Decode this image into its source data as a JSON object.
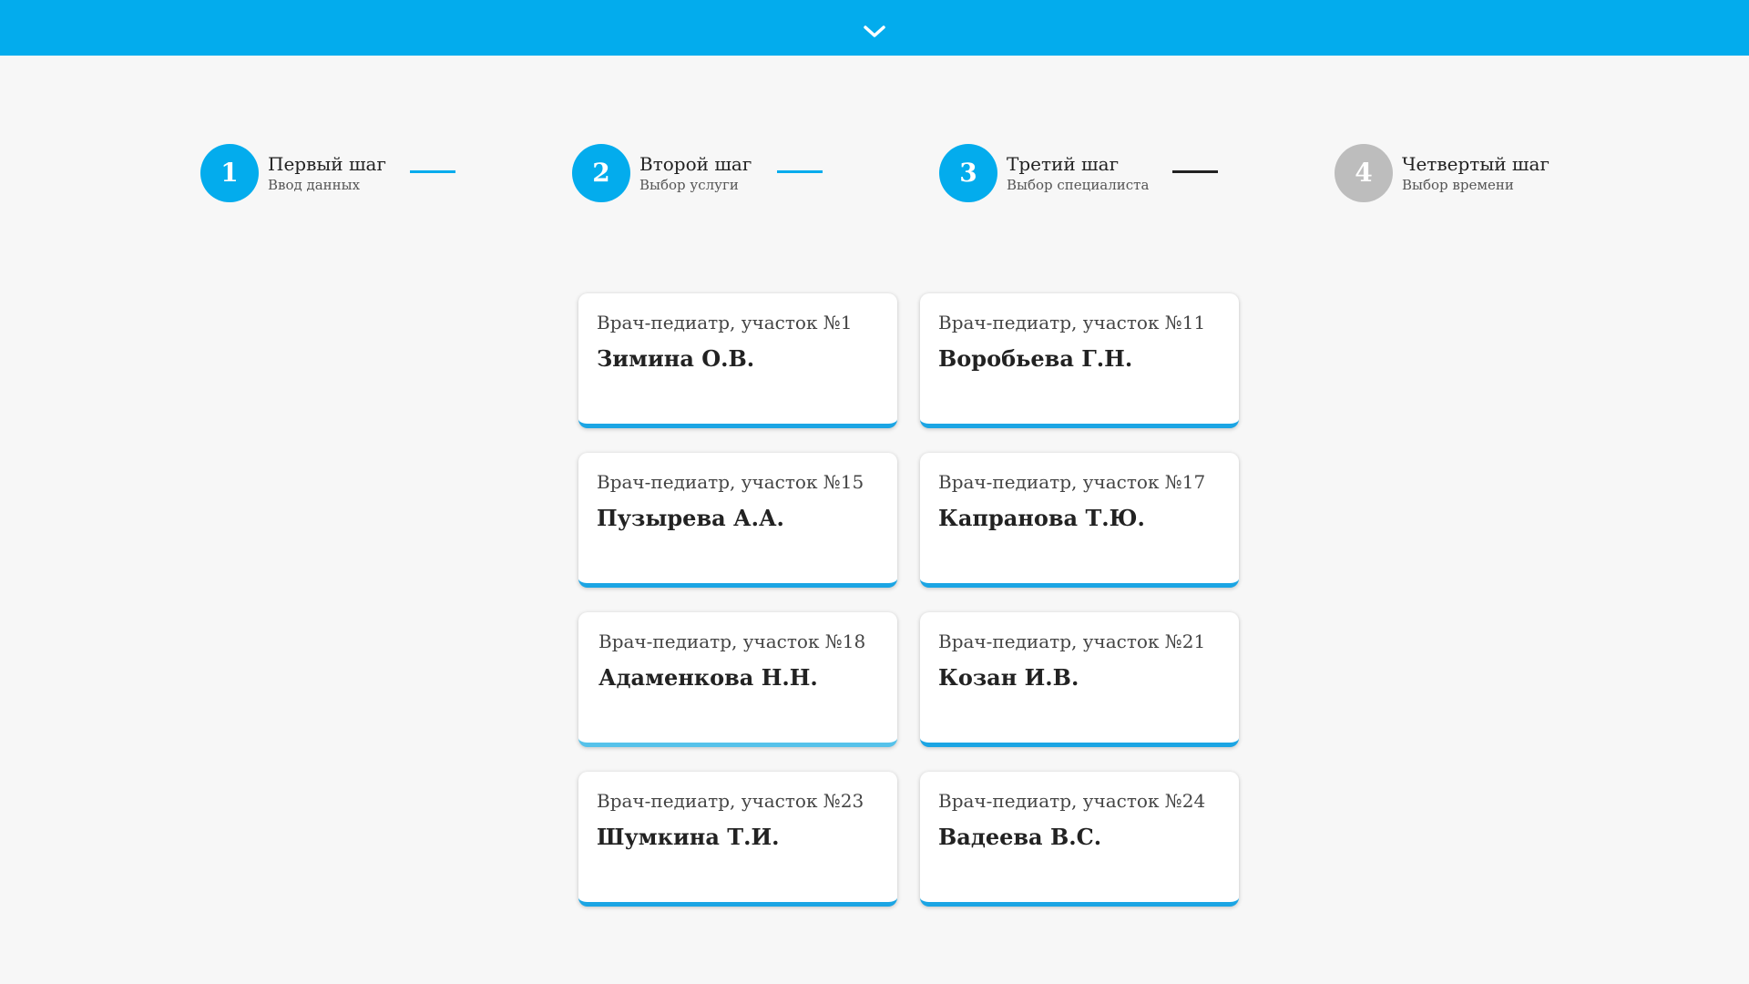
{
  "theme": {
    "accent": "#03aced",
    "inactive": "#bdbdbd",
    "card_bar": "#1ba5e4",
    "background": "#f7f7f7"
  },
  "topbar": {
    "toggle_icon": "chevron-down-icon"
  },
  "steps": [
    {
      "number": "1",
      "title": "Первый шаг",
      "subtitle": "Ввод данных",
      "state": "active"
    },
    {
      "number": "2",
      "title": "Второй шаг",
      "subtitle": "Выбор услуги",
      "state": "active"
    },
    {
      "number": "3",
      "title": "Третий шаг",
      "subtitle": "Выбор специалиста",
      "state": "active"
    },
    {
      "number": "4",
      "title": "Четвертый шаг",
      "subtitle": "Выбор времени",
      "state": "inactive"
    }
  ],
  "doctors": [
    {
      "role": "Врач-педиатр, участок №1",
      "name": "Зимина О.В."
    },
    {
      "role": "Врач-педиатр, участок №11",
      "name": "Воробьева Г.Н."
    },
    {
      "role": "Врач-педиатр, участок №15",
      "name": "Пузырева А.А."
    },
    {
      "role": "Врач-педиатр, участок №17",
      "name": "Капранова Т.Ю."
    },
    {
      "role": "Врач-педиатр, участок №18",
      "name": "Адаменкова Н.Н."
    },
    {
      "role": "Врач-педиатр, участок №21",
      "name": "Козан И.В."
    },
    {
      "role": "Врач-педиатр, участок №23",
      "name": "Шумкина Т.И."
    },
    {
      "role": "Врач-педиатр, участок №24",
      "name": "Вадеева В.С."
    }
  ]
}
